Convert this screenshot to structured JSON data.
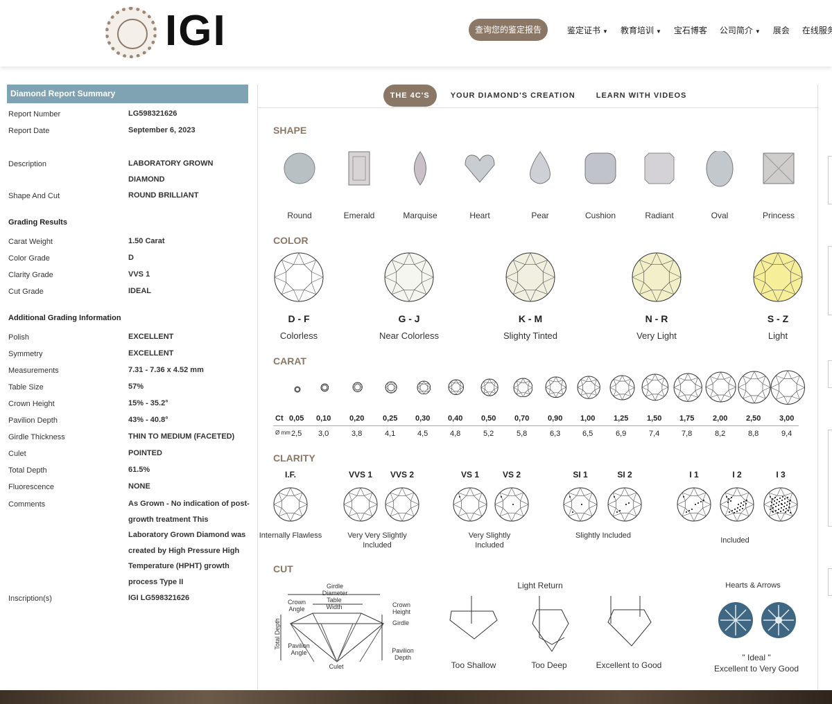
{
  "header": {
    "logo": "IGI",
    "cta": "查询您的鉴定报告",
    "nav": [
      {
        "label": "鉴定证书",
        "dropdown": true
      },
      {
        "label": "教育培训",
        "dropdown": true
      },
      {
        "label": "宝石博客",
        "dropdown": false
      },
      {
        "label": "公司简介",
        "dropdown": true
      },
      {
        "label": "展会",
        "dropdown": false
      },
      {
        "label": "在线服务",
        "dropdown": false
      }
    ]
  },
  "summary": {
    "title": "Diamond Report Summary",
    "rows": [
      {
        "label": "Report Number",
        "value": "LG598321626"
      },
      {
        "label": "Report Date",
        "value": "September 6, 2023"
      },
      {
        "label": "Description",
        "value": "LABORATORY GROWN DIAMOND"
      },
      {
        "label": "Shape And Cut",
        "value": "ROUND BRILLIANT"
      },
      {
        "label": "Grading Results",
        "value": "",
        "heading": true
      },
      {
        "label": "Carat Weight",
        "value": "1.50 Carat"
      },
      {
        "label": "Color Grade",
        "value": "D"
      },
      {
        "label": "Clarity Grade",
        "value": "VVS 1"
      },
      {
        "label": "Cut Grade",
        "value": "IDEAL"
      },
      {
        "label": "Additional Grading Information",
        "value": "",
        "heading": true
      },
      {
        "label": "Polish",
        "value": "EXCELLENT"
      },
      {
        "label": "Symmetry",
        "value": "EXCELLENT"
      },
      {
        "label": "Measurements",
        "value": "7.31 - 7.36 x 4.52 mm"
      },
      {
        "label": "Table Size",
        "value": "57%"
      },
      {
        "label": "Crown Height",
        "value": "15% - 35.2°"
      },
      {
        "label": "Pavilion Depth",
        "value": "43% - 40.8°"
      },
      {
        "label": "Girdle Thickness",
        "value": "THIN TO MEDIUM (FACETED)"
      },
      {
        "label": "Culet",
        "value": "POINTED"
      },
      {
        "label": "Total Depth",
        "value": "61.5%"
      },
      {
        "label": "Fluorescence",
        "value": "NONE"
      },
      {
        "label": "Comments",
        "value": "As Grown - No indication of post-growth treatment This Laboratory Grown Diamond was created by High Pressure High Temperature (HPHT) growth process Type II"
      },
      {
        "label": "Inscription(s)",
        "value": "IGI LG598321626"
      }
    ]
  },
  "tabs": [
    {
      "label": "THE 4C'S",
      "active": true
    },
    {
      "label": "YOUR DIAMOND'S CREATION",
      "active": false
    },
    {
      "label": "LEARN WITH VIDEOS",
      "active": false
    }
  ],
  "shape": {
    "title": "SHAPE",
    "items": [
      "Round",
      "Emerald",
      "Marquise",
      "Heart",
      "Pear",
      "Cushion",
      "Radiant",
      "Oval",
      "Princess"
    ]
  },
  "color": {
    "title": "COLOR",
    "items": [
      {
        "grade": "D - F",
        "name": "Colorless",
        "tint": "#ffffff"
      },
      {
        "grade": "G - J",
        "name": "Near Colorless",
        "tint": "#f6f6f0"
      },
      {
        "grade": "K - M",
        "name": "Slighty Tinted",
        "tint": "#f0efe0"
      },
      {
        "grade": "N - R",
        "name": "Very Light",
        "tint": "#f2f0c8"
      },
      {
        "grade": "S - Z",
        "name": "Light",
        "tint": "#f7ee9a"
      }
    ]
  },
  "carat": {
    "title": "CARAT",
    "ct_label": "Ct",
    "mm_label": "Ø mm",
    "ct": [
      "0,05",
      "0,10",
      "0,20",
      "0,25",
      "0,30",
      "0,40",
      "0,50",
      "0,70",
      "0,90",
      "1,00",
      "1,25",
      "1,50",
      "1,75",
      "2,00",
      "2,50",
      "3,00"
    ],
    "mm": [
      "2,5",
      "3,0",
      "3,8",
      "4,1",
      "4,5",
      "4,8",
      "5,2",
      "5,8",
      "6,3",
      "6,5",
      "6,9",
      "7,4",
      "7,8",
      "8,2",
      "8,8",
      "9,4"
    ]
  },
  "clarity": {
    "title": "CLARITY",
    "grades": [
      "I.F.",
      "VVS 1",
      "VVS 2",
      "VS 1",
      "VS 2",
      "SI 1",
      "SI 2",
      "I 1",
      "I 2",
      "I 3"
    ],
    "groups": [
      "Internally Flawless",
      "Very Very Slightly Included",
      "Very Slightly Included",
      "Slightly Included",
      "Included"
    ]
  },
  "cut": {
    "title": "CUT",
    "diagram": {
      "girdle_diameter": "Girdle Diameter",
      "table_width": "Table Width",
      "crown_angle": "Crown Angle",
      "crown_height": "Crown Height",
      "girdle": "Girdle",
      "total_depth": "Total Depth",
      "pavilion_angle": "Pavilion Angle",
      "pavilion_depth": "Pavilion Depth",
      "culet": "Culet"
    },
    "light_return": "Light Return",
    "examples": [
      "Too Shallow",
      "Too Deep",
      "Excellent to Good"
    ],
    "hearts_arrows": "Hearts & Arrows",
    "ideal": "\" Ideal \"",
    "ideal_sub": "Excellent to Very Good"
  }
}
